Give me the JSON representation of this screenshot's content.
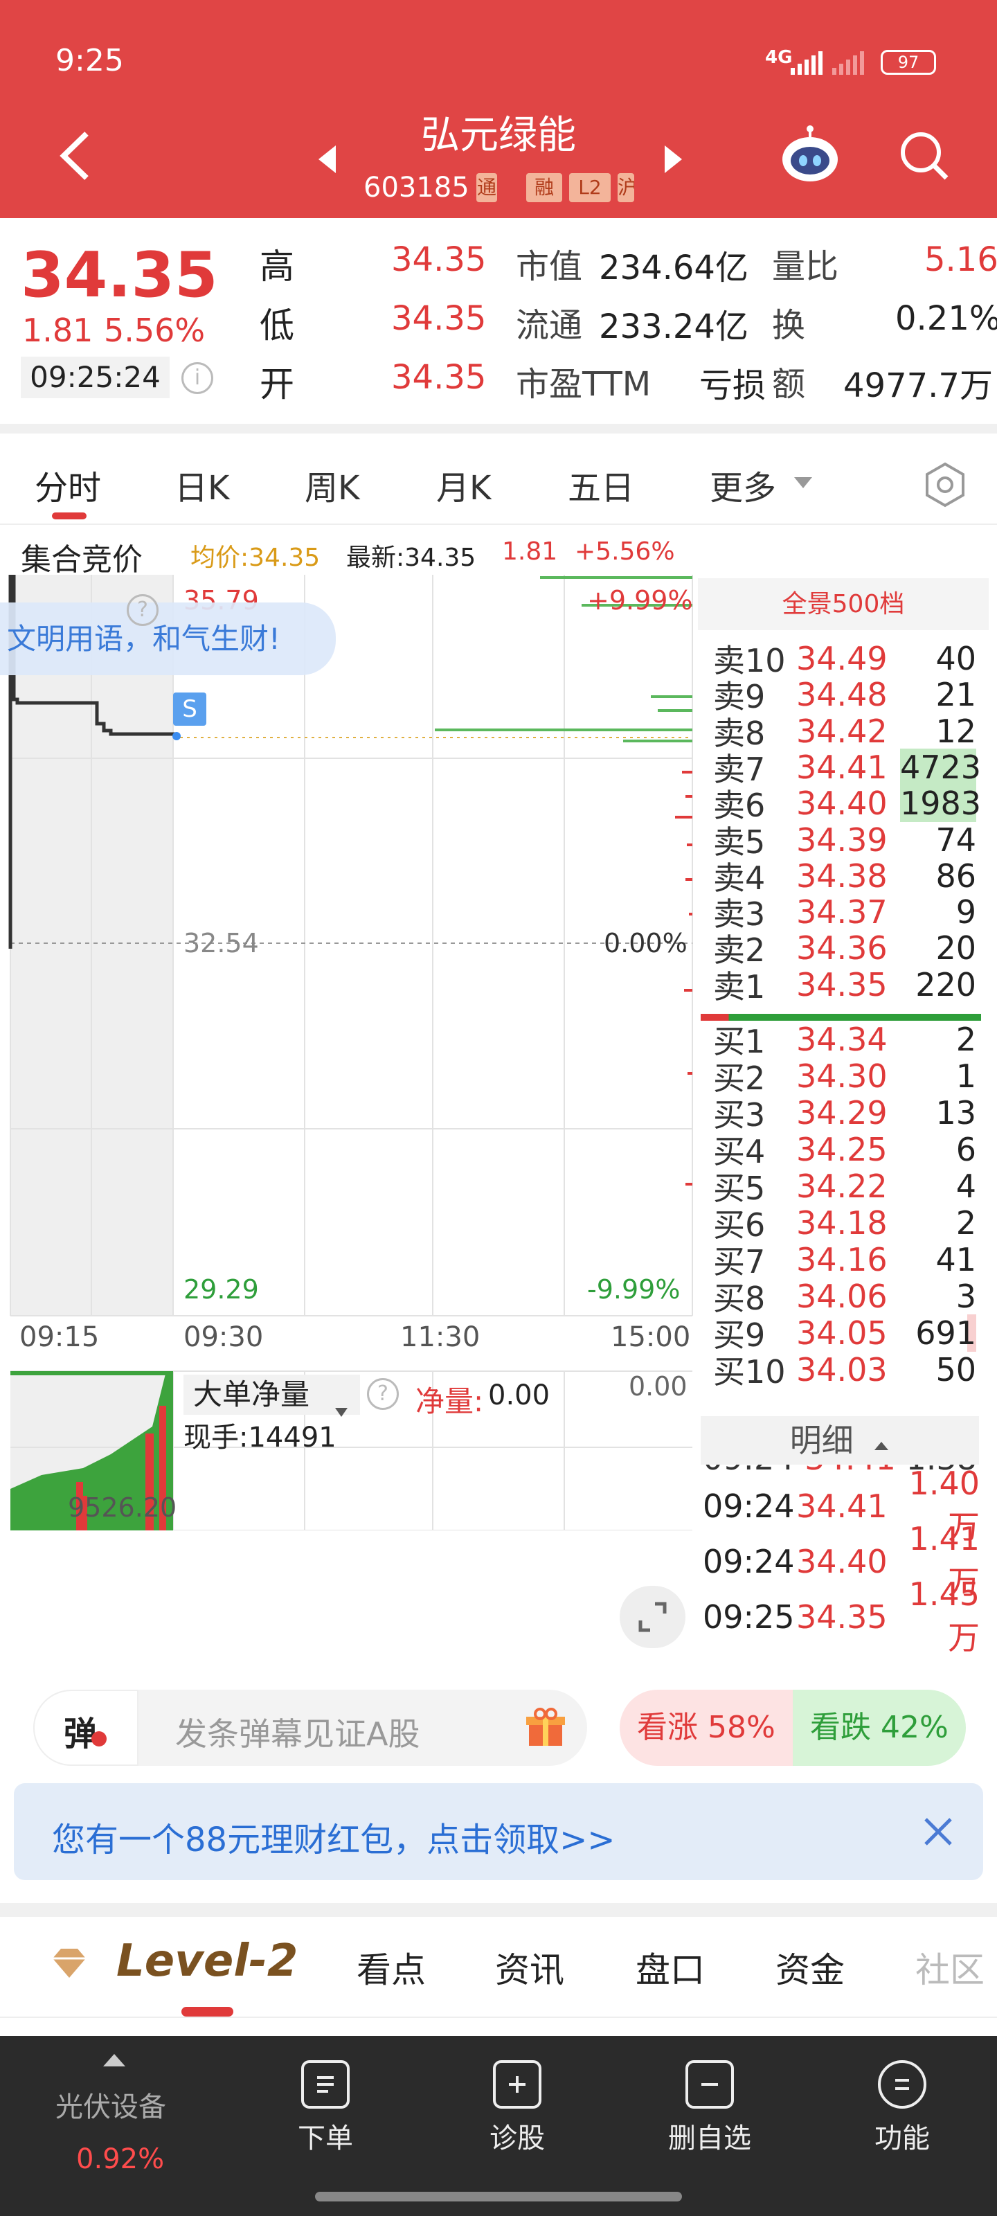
{
  "status_bar": {
    "time": "9:25",
    "network": "4G",
    "battery": "97"
  },
  "header": {
    "title": "弘元绿能",
    "code": "603185",
    "badges": [
      "通",
      "融",
      "L2",
      "沪"
    ]
  },
  "quote": {
    "price": "34.35",
    "change": "1.81",
    "change_pct": "5.56%",
    "time": "09:25:24",
    "fields": [
      {
        "label": "高",
        "value": "34.35"
      },
      {
        "label": "低",
        "value": "34.35"
      },
      {
        "label": "开",
        "value": "34.35"
      }
    ],
    "mid": [
      {
        "label": "市值",
        "value": "234.64亿"
      },
      {
        "label": "流通",
        "value": "233.24亿"
      },
      {
        "label": "市盈TTM",
        "value": "亏损"
      }
    ],
    "right": [
      {
        "label": "量比",
        "value": "5.16"
      },
      {
        "label": "换",
        "value": "0.21%"
      },
      {
        "label": "额",
        "value": "4977.7万"
      }
    ]
  },
  "tabs": [
    "分时",
    "日K",
    "周K",
    "月K",
    "五日",
    "更多"
  ],
  "auction": {
    "label": "集合竞价",
    "avg": "均价:34.35",
    "latest": "最新:34.35",
    "chg": "1.81",
    "pct": "+5.56%"
  },
  "chart": {
    "top_price": "35.79",
    "mid_price": "32.54",
    "bot_price": "29.29",
    "top_pct": "+9.99%",
    "mid_pct": "0.00%",
    "bot_pct": "-9.99%",
    "bubble": "文明用语，和气生财!",
    "s_marker": "S",
    "times": [
      "09:15",
      "09:30",
      "11:30",
      "15:00"
    ]
  },
  "sub_chart": {
    "indicator": "大单净量",
    "net_label": "净量:",
    "net_value": "0.00",
    "right_value": "0.00",
    "hands": "现手:14491",
    "level": "9526.20"
  },
  "orderbook": {
    "title": "全景500档",
    "sells": [
      {
        "l": "卖10",
        "p": "34.49",
        "v": "40"
      },
      {
        "l": "卖9",
        "p": "34.48",
        "v": "21"
      },
      {
        "l": "卖8",
        "p": "34.42",
        "v": "12"
      },
      {
        "l": "卖7",
        "p": "34.41",
        "v": "4723"
      },
      {
        "l": "卖6",
        "p": "34.40",
        "v": "1983"
      },
      {
        "l": "卖5",
        "p": "34.39",
        "v": "74"
      },
      {
        "l": "卖4",
        "p": "34.38",
        "v": "86"
      },
      {
        "l": "卖3",
        "p": "34.37",
        "v": "9"
      },
      {
        "l": "卖2",
        "p": "34.36",
        "v": "20"
      },
      {
        "l": "卖1",
        "p": "34.35",
        "v": "220"
      }
    ],
    "buys": [
      {
        "l": "买1",
        "p": "34.34",
        "v": "2"
      },
      {
        "l": "买2",
        "p": "34.30",
        "v": "1"
      },
      {
        "l": "买3",
        "p": "34.29",
        "v": "13"
      },
      {
        "l": "买4",
        "p": "34.25",
        "v": "6"
      },
      {
        "l": "买5",
        "p": "34.22",
        "v": "4"
      },
      {
        "l": "买6",
        "p": "34.18",
        "v": "2"
      },
      {
        "l": "买7",
        "p": "34.16",
        "v": "41"
      },
      {
        "l": "买8",
        "p": "34.06",
        "v": "3"
      },
      {
        "l": "买9",
        "p": "34.05",
        "v": "691"
      },
      {
        "l": "买10",
        "p": "34.03",
        "v": "50"
      }
    ],
    "detail_label": "明细",
    "details": [
      {
        "t": "09:24",
        "p": "34.41",
        "v": "1.40万"
      },
      {
        "t": "09:24",
        "p": "34.40",
        "v": "1.41万"
      },
      {
        "t": "09:25",
        "p": "34.35",
        "v": "1.45万"
      }
    ]
  },
  "danmu": {
    "label": "弹",
    "placeholder": "发条弹幕见证A股",
    "up": "看涨 58%",
    "down": "看跌 42%"
  },
  "banner": {
    "text": "您有一个88元理财红包，点击领取>>"
  },
  "bottom_tabs": [
    "Level-2",
    "看点",
    "资讯",
    "盘口",
    "资金",
    "社区"
  ],
  "nav": {
    "sector": "光伏设备",
    "sector_pct": "0.92%",
    "items": [
      {
        "label": "下单",
        "icon": "form"
      },
      {
        "label": "诊股",
        "icon": "plus"
      },
      {
        "label": "删自选",
        "icon": "minus"
      },
      {
        "label": "功能",
        "icon": "menu"
      }
    ]
  }
}
